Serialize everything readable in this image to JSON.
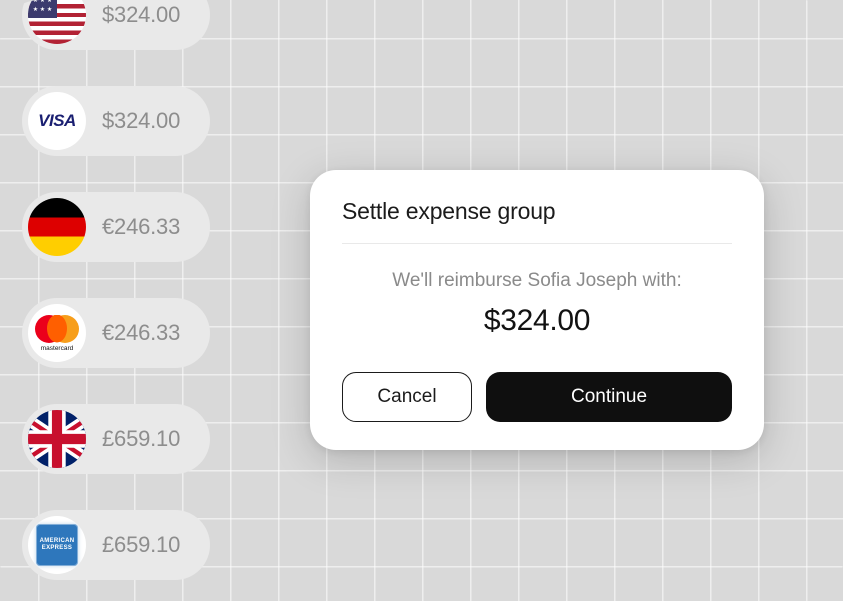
{
  "payment_pills": [
    {
      "icon": "flag-us",
      "amount": "$324.00"
    },
    {
      "icon": "brand-visa",
      "amount": "$324.00"
    },
    {
      "icon": "flag-de",
      "amount": "€246.33"
    },
    {
      "icon": "brand-mc",
      "amount": "€246.33"
    },
    {
      "icon": "flag-uk",
      "amount": "£659.10"
    },
    {
      "icon": "brand-amex",
      "amount": "£659.10"
    }
  ],
  "dialog": {
    "title": "Settle expense group",
    "message": "We'll reimburse Sofia Joseph with:",
    "amount": "$324.00",
    "cancel_label": "Cancel",
    "continue_label": "Continue"
  },
  "brand_labels": {
    "visa": "VISA",
    "mastercard": "mastercard",
    "amex_line1": "AMERICAN",
    "amex_line2": "EXPRESS"
  }
}
